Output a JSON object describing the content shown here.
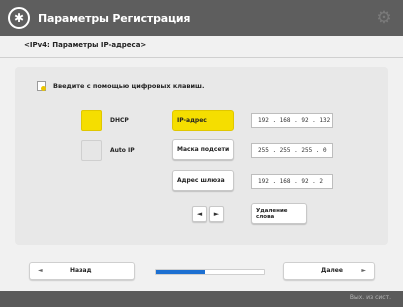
{
  "header": {
    "title": "Параметры Регистрация",
    "icon": "gear-circle-icon"
  },
  "breadcrumb": "<IPv4: Параметры IP-адреса>",
  "instruction": "Введите с помощью цифровых клавиш.",
  "options": {
    "dhcp": {
      "label": "DHCP",
      "selected": true
    },
    "auto_ip": {
      "label": "Auto IP",
      "selected": false
    }
  },
  "fields": [
    {
      "label": "IP-адрес",
      "value": "192 . 168 . 92 . 132",
      "active": true
    },
    {
      "label": "Маска подсети",
      "value": "255 . 255 . 255 . 0",
      "active": false
    },
    {
      "label": "Адрес шлюза",
      "value": "192 . 168 . 92 . 2",
      "active": false
    }
  ],
  "controls": {
    "left_arrow": "◄",
    "right_arrow": "►",
    "backspace_label": "Удаление слова"
  },
  "nav": {
    "back_label": "Назад",
    "next_label": "Далее",
    "back_arrow": "◄",
    "next_arrow": "►",
    "progress_fraction": 0.45
  },
  "footer": {
    "status_text": "Вых. из сист."
  },
  "colors": {
    "accent_yellow": "#f5de00",
    "progress_blue": "#1c6fd1",
    "titlebar": "#5e5e5e"
  }
}
